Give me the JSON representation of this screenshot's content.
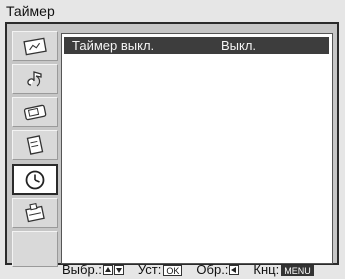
{
  "window": {
    "title": "Таймер"
  },
  "sidebar": {
    "items": [
      {
        "icon": "picture-menu-icon",
        "active": false
      },
      {
        "icon": "sound-menu-icon",
        "active": false
      },
      {
        "icon": "screen-menu-icon",
        "active": false
      },
      {
        "icon": "features-menu-icon",
        "active": false
      },
      {
        "icon": "clock-icon",
        "active": true
      },
      {
        "icon": "setup-menu-icon",
        "active": false
      },
      {
        "icon": "empty-slot",
        "active": false
      }
    ]
  },
  "main": {
    "rows": [
      {
        "label": "Таймер выкл.",
        "value": "Выкл.",
        "selected": true
      }
    ]
  },
  "help_bar": {
    "select_label": "Выбр.:",
    "set_label": "Уст:",
    "set_key": "OK",
    "back_label": "Обр.:",
    "exit_label": "Кнц:",
    "exit_key": "MENU"
  },
  "colors": {
    "background": "#e6e6e6",
    "frame": "#c6c6c6",
    "highlight": "#3d3d3d",
    "content": "#ffffff"
  }
}
